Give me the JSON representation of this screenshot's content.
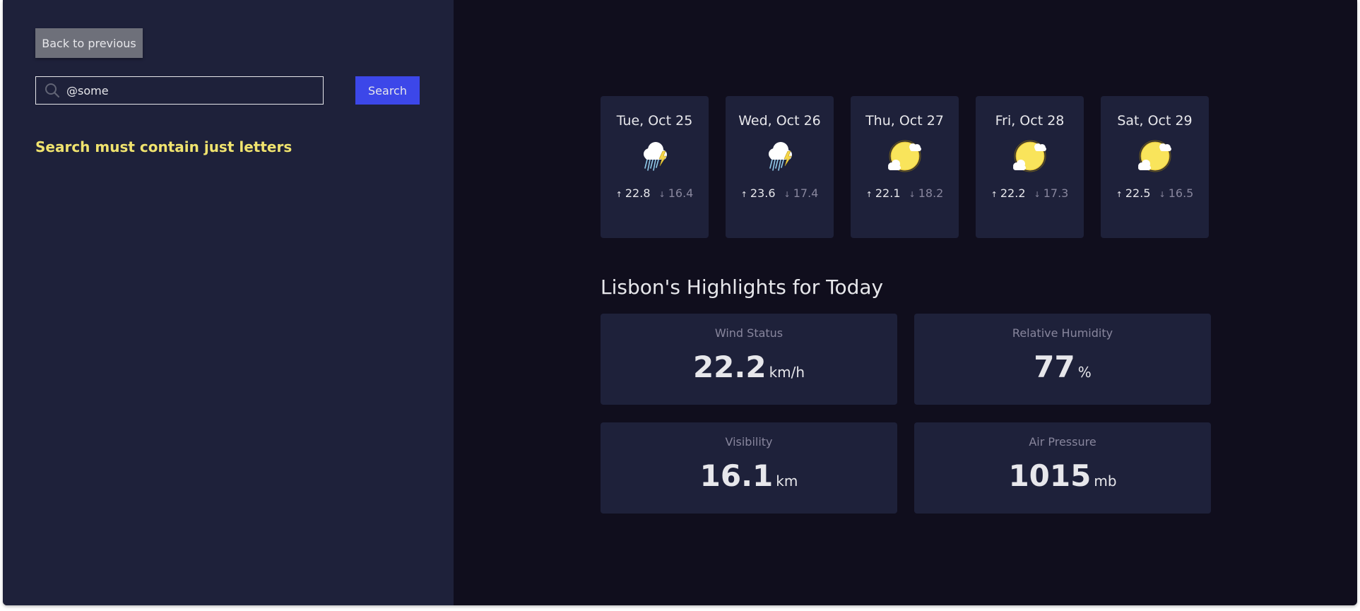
{
  "sidebar": {
    "back_label": "Back to previous",
    "search": {
      "value": "@some",
      "button_label": "Search"
    },
    "error": "Search must contain just letters"
  },
  "forecast": [
    {
      "date": "Tue, Oct 25",
      "icon": "thunderstorm-icon",
      "max": "22.8",
      "min": "16.4"
    },
    {
      "date": "Wed, Oct 26",
      "icon": "thunderstorm-icon",
      "max": "23.6",
      "min": "17.4"
    },
    {
      "date": "Thu, Oct 27",
      "icon": "sun-with-clouds-icon",
      "max": "22.1",
      "min": "18.2"
    },
    {
      "date": "Fri, Oct 28",
      "icon": "sun-with-clouds-icon",
      "max": "22.2",
      "min": "17.3"
    },
    {
      "date": "Sat, Oct 29",
      "icon": "sun-with-clouds-icon",
      "max": "22.5",
      "min": "16.5"
    }
  ],
  "highlights": {
    "title": "Lisbon's Highlights for Today",
    "wind": {
      "label": "Wind Status",
      "value": "22.2",
      "unit": "km/h"
    },
    "humidity": {
      "label": "Relative Humidity",
      "value": "77",
      "unit": "%"
    },
    "visibility": {
      "label": "Visibility",
      "value": "16.1",
      "unit": "km"
    },
    "pressure": {
      "label": "Air Pressure",
      "value": "1015",
      "unit": "mb"
    }
  },
  "arrows": {
    "up": "↑",
    "down": "↓"
  },
  "colors": {
    "accent": "#3c47e9",
    "error": "#f0e36e",
    "sidebar_bg": "#1e213a",
    "main_bg": "#100e1d"
  }
}
